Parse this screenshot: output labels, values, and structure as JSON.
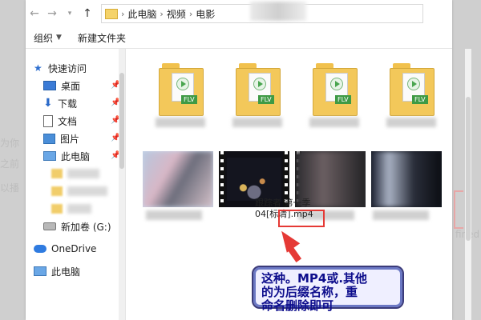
{
  "window": {
    "breadcrumb": [
      "此电脑",
      "视频",
      "电影"
    ],
    "toolbar": {
      "organize": "组织",
      "new_folder": "新建文件夹"
    }
  },
  "sidebar": {
    "items": [
      {
        "label": "快速访问",
        "icon": "star-icon",
        "pinned": false
      },
      {
        "label": "桌面",
        "icon": "desktop-icon",
        "pinned": true
      },
      {
        "label": "下载",
        "icon": "download-icon",
        "pinned": true
      },
      {
        "label": "文档",
        "icon": "document-icon",
        "pinned": true
      },
      {
        "label": "图片",
        "icon": "pictures-icon",
        "pinned": true
      },
      {
        "label": "此电脑",
        "icon": "computer-icon",
        "pinned": true
      },
      {
        "label": "新加卷 (G:)",
        "icon": "drive-icon",
        "pinned": false
      },
      {
        "label": "OneDrive",
        "icon": "onedrive-icon",
        "pinned": false
      },
      {
        "label": "此电脑",
        "icon": "computer-icon",
        "pinned": false
      }
    ]
  },
  "content": {
    "folders": [
      {
        "badge": "FLV"
      },
      {
        "badge": "FLV"
      },
      {
        "badge": "FLV"
      },
      {
        "badge": "FLV"
      }
    ],
    "videos": [
      {
        "name_line1": "",
        "name_line2": ""
      },
      {
        "name_line1": "跟踪者 第一季",
        "name_line2": "04[标清].mp4"
      },
      {
        "name_line1": "",
        "name_line2": ""
      },
      {
        "name_line1": "",
        "name_line2": ""
      }
    ]
  },
  "annotation": {
    "callout_lines": [
      "这种。MP4或.其他",
      "的为后缀名称，重",
      "命名删除即可"
    ]
  },
  "background_text": [
    "为你",
    "之前",
    "以播",
    "fined"
  ]
}
